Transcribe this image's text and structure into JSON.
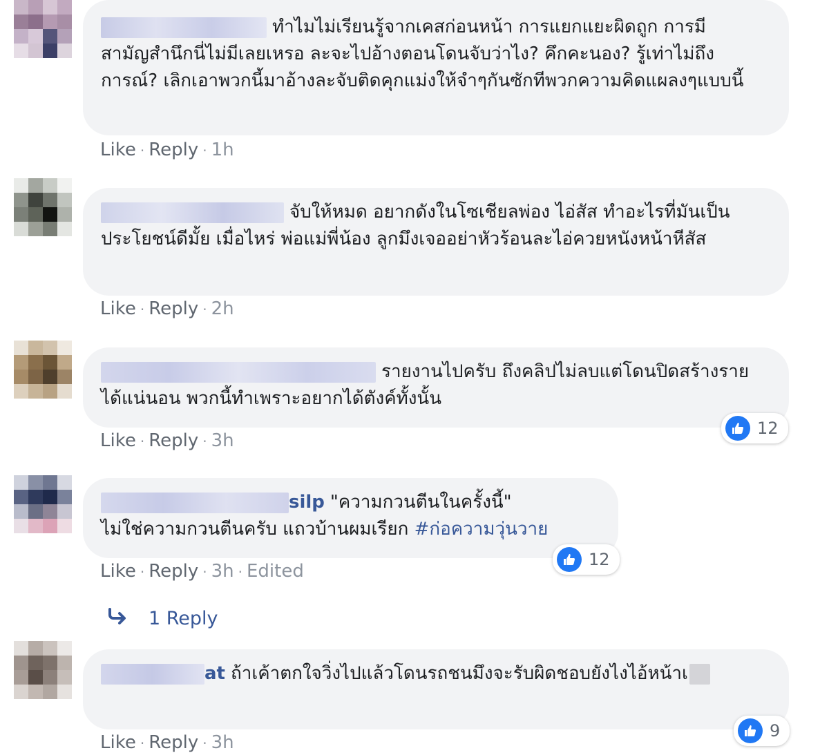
{
  "comments": [
    {
      "author_visible": "",
      "text": "ทำไมไม่เรียนรู้จากเคสก่อนหน้า การแยกแยะผิดถูก การมีสามัญสำนึกนี่ไม่มีเลยเหรอ ละจะไปอ้างตอนโดนจับว่าไง? คึกคะนอง? รู้เท่าไม่ถึงการณ์? เลิกเอาพวกนี้มาอ้างละจับติดคุกแม่งให้จำๆกันซักทีพวกความคิดแผลงๆแบบนี้",
      "like": "Like",
      "reply": "Reply",
      "time": "1h"
    },
    {
      "author_visible": "",
      "text": "จับให้หมด อยากดังในโซเชียลพ่อง ไอ่สัส ทำอะไรที่มันเป็นประโยชน์ดีมั้ย เมื่อไหร่ พ่อแม่พี่น้อง ลูกมึงเจออย่าหัวร้อนละไอ่ควยหนังหน้าหีสัส",
      "like": "Like",
      "reply": "Reply",
      "time": "2h"
    },
    {
      "author_visible": "",
      "text": "รายงานไปครับ ถึงคลิปไม่ลบแต่โดนปิดสร้างรายได้แน่นอน พวกนี้ทำเพราะอยากได้ตังค์ทั้งนั้น",
      "like": "Like",
      "reply": "Reply",
      "time": "3h",
      "reactions": "12"
    },
    {
      "author_visible": "silp",
      "text_line1": "\"ความกวนตีนในครั้งนี้\"",
      "text_line2": "ไม่ใช่ความกวนตีนครับ แถวบ้านผมเรียก",
      "hashtag": "#ก่อความวุ่นวาย",
      "like": "Like",
      "reply": "Reply",
      "time": "3h",
      "edited": "Edited",
      "reactions": "12"
    },
    {
      "author_visible": "at",
      "text": "ถ้าเค้าตกใจวิ่งไปแล้วโดนรถชนมึงจะรับผิดชอบยังไงไอ้หน้าเ",
      "like": "Like",
      "reply": "Reply",
      "time": "3h",
      "reactions": "9"
    }
  ],
  "reply_thread": {
    "label": "1 Reply"
  },
  "colors": {
    "bubble": "#f2f3f5",
    "link": "#385898",
    "meta": "#606770",
    "like_blue": "#2078f4"
  },
  "icons": [
    "like-thumb-icon",
    "reply-arrow-icon"
  ]
}
